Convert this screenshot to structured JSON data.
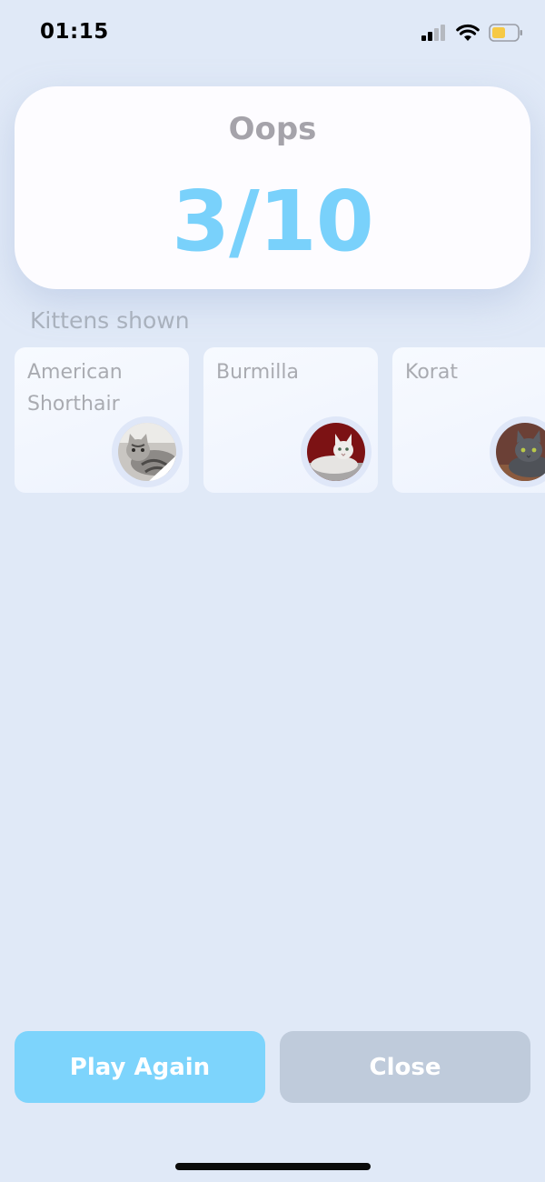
{
  "status_bar": {
    "time": "01:15",
    "icons": [
      "cellular-signal-icon",
      "wifi-icon",
      "battery-low-icon"
    ],
    "battery_color": "#f6c945"
  },
  "result": {
    "title": "Oops",
    "score": "3/10",
    "score_color": "#79d1fb"
  },
  "kittens": {
    "label": "Kittens shown",
    "items": [
      {
        "name": "American Shorthair",
        "photo": "american-shorthair-photo"
      },
      {
        "name": "Burmilla",
        "photo": "burmilla-photo"
      },
      {
        "name": "Korat",
        "photo": "korat-photo"
      }
    ]
  },
  "actions": {
    "play_again": "Play Again",
    "close": "Close",
    "play_color": "#7dd4fc",
    "close_color": "#bfcbdb"
  }
}
